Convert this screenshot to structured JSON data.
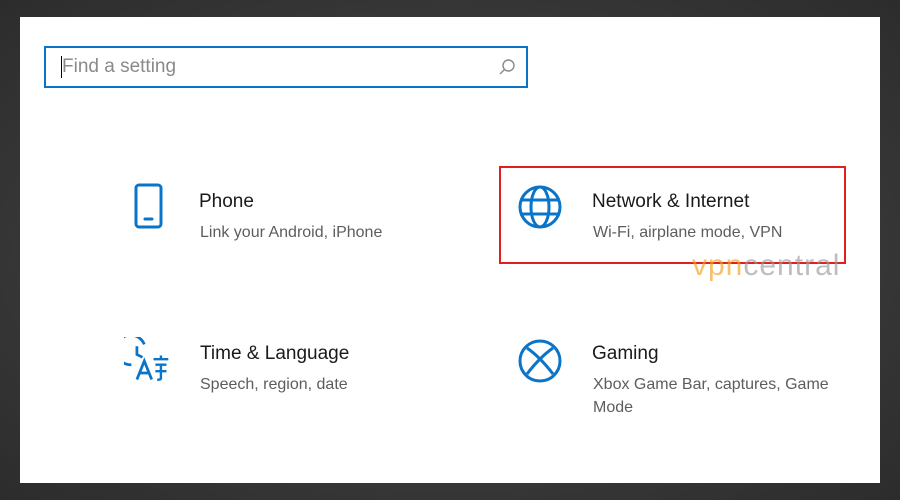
{
  "search": {
    "placeholder": "Find a setting",
    "value": ""
  },
  "tiles": [
    {
      "title": "Phone",
      "description": "Link your Android, iPhone",
      "icon": "phone-icon"
    },
    {
      "title": "Network & Internet",
      "description": "Wi-Fi, airplane mode, VPN",
      "icon": "globe-icon"
    },
    {
      "title": "Time & Language",
      "description": "Speech, region, date",
      "icon": "time-language-icon"
    },
    {
      "title": "Gaming",
      "description": "Xbox Game Bar, captures, Game Mode",
      "icon": "xbox-icon"
    }
  ],
  "watermark": {
    "brand_part1": "vpn",
    "brand_part2": "central"
  },
  "colors": {
    "accent": "#0a74c9",
    "highlight": "#e02020",
    "watermark_orange": "#f0a020"
  }
}
